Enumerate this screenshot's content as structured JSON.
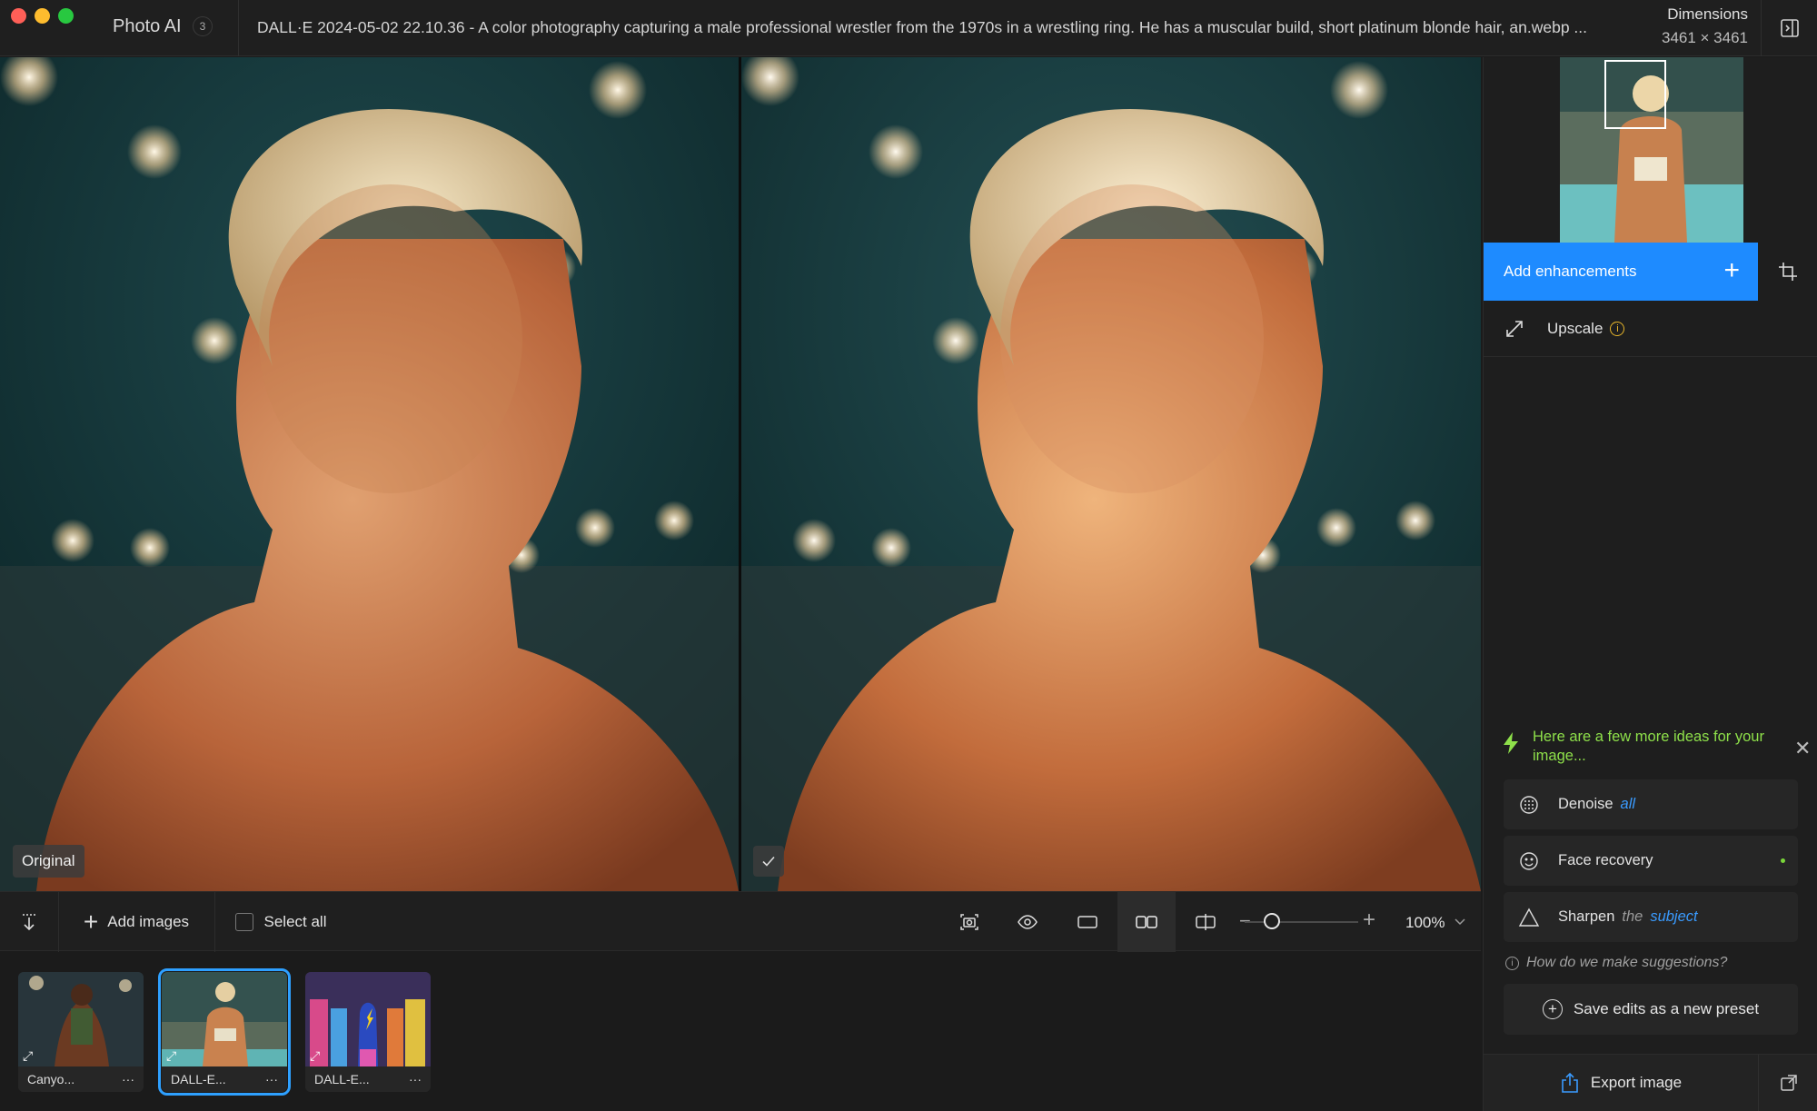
{
  "window": {
    "app_name": "Photo AI",
    "image_count": "3",
    "file_title": "DALL·E 2024-05-02 22.10.36 - A color photography capturing a male professional wrestler from the 1970s in a wrestling ring. He has a muscular build, short platinum blonde hair, an.webp ...",
    "dimensions_label": "Dimensions",
    "dimensions_value": "3461 × 3461"
  },
  "viewer": {
    "original_label": "Original"
  },
  "toolbar": {
    "add_images": "Add images",
    "select_all": "Select all",
    "zoom_level": "100%",
    "zoom_slider_fraction": 0.2
  },
  "filmstrip": {
    "items": [
      {
        "label": "Canyo...",
        "more": "···"
      },
      {
        "label": "DALL-E...",
        "more": "···"
      },
      {
        "label": "DALL-E...",
        "more": "···"
      }
    ]
  },
  "sidebar": {
    "add_enhancements": "Add enhancements",
    "upscale": "Upscale",
    "ideas_text": "Here are a few more ideas for your image...",
    "suggestions": [
      {
        "label": "Denoise",
        "suffix_muted": "",
        "suffix_accent": "all"
      },
      {
        "label": "Face recovery",
        "suffix_muted": "",
        "suffix_accent": ""
      },
      {
        "label": "Sharpen",
        "suffix_muted": "the",
        "suffix_accent": "subject"
      }
    ],
    "how_suggestions": "How do we make suggestions?",
    "save_preset": "Save edits as a new preset",
    "export": "Export image"
  },
  "colors": {
    "accent": "#1e8bff",
    "ideas_green": "#8ee04a",
    "upscale_info": "#e7b52a"
  }
}
